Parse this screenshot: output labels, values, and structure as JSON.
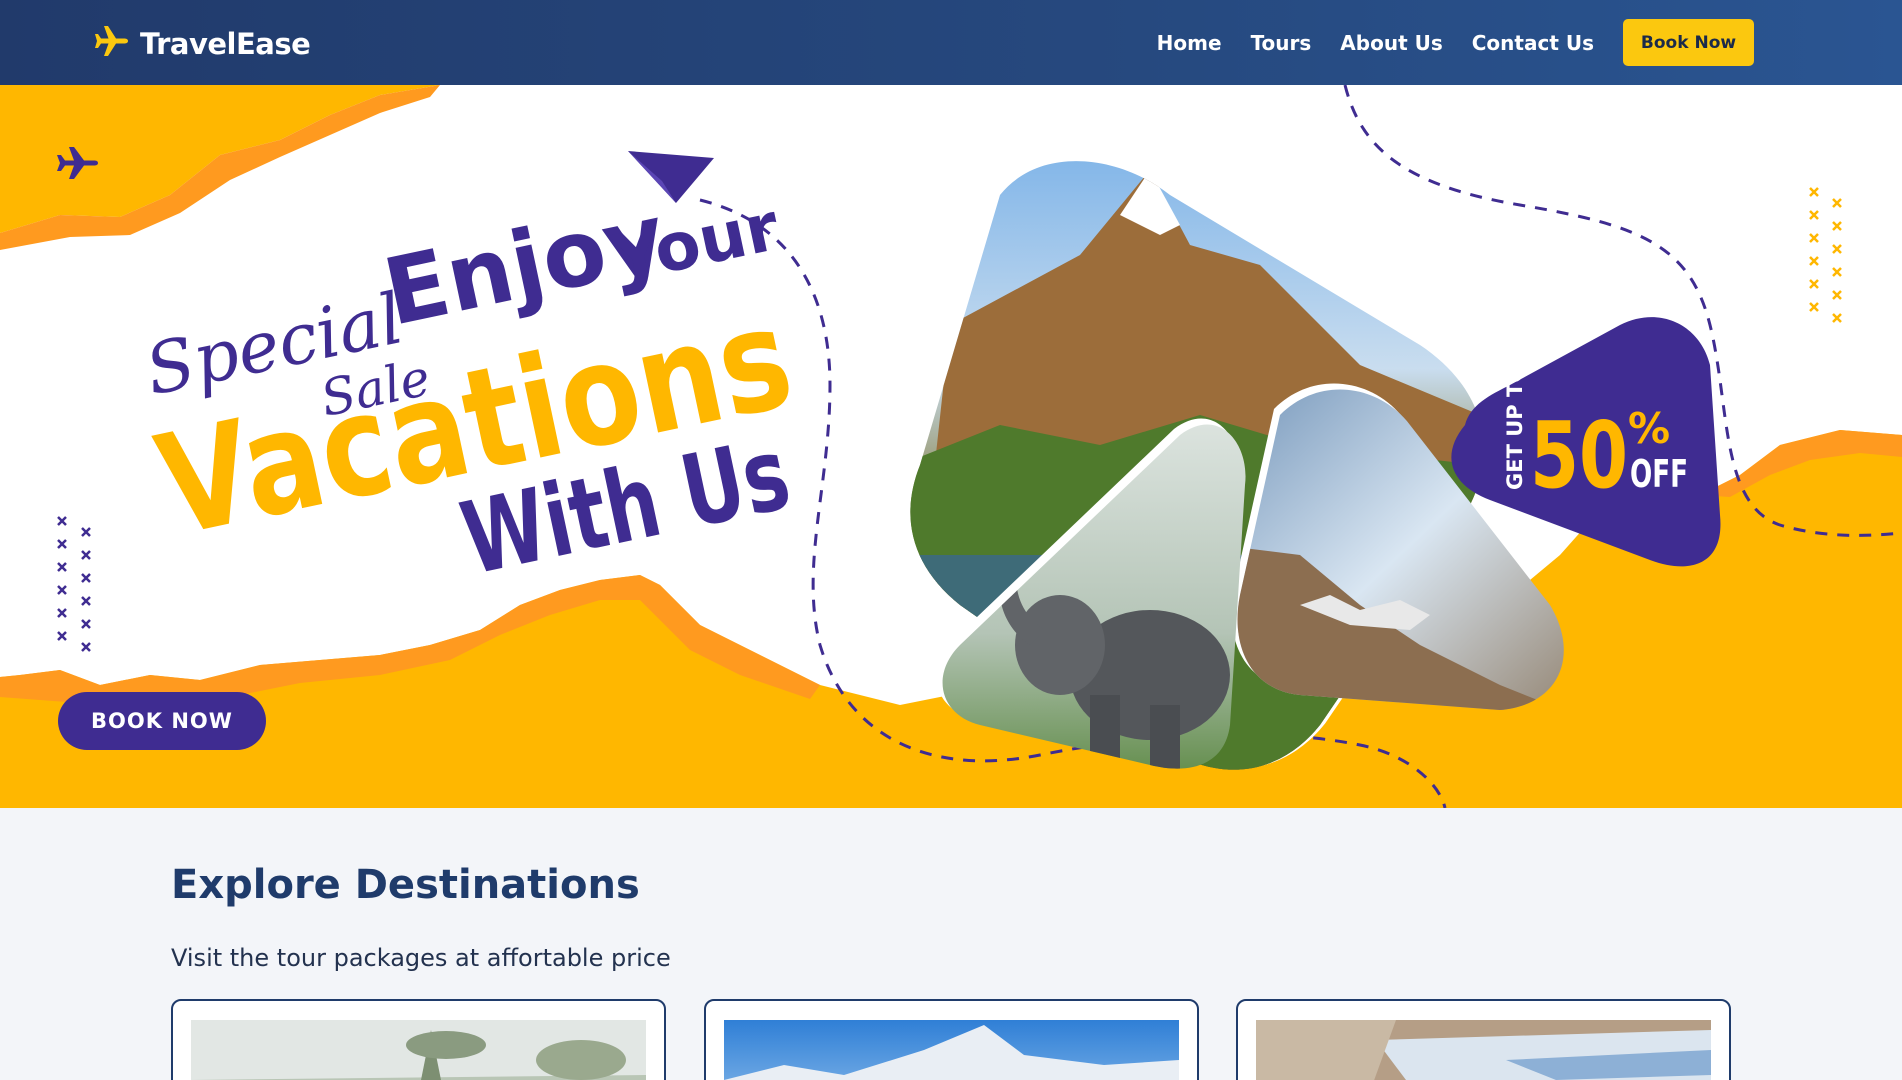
{
  "navbar": {
    "brand": "TravelEase",
    "brand_icon": "plane-icon",
    "links": [
      "Home",
      "Tours",
      "About Us",
      "Contact Us"
    ],
    "cta": "Book Now"
  },
  "hero": {
    "script_line1": "Special",
    "script_line2": "Sale",
    "headline_enjoy": "Enjoy",
    "headline_your": "Your",
    "headline_vacations": "Vacations",
    "headline_with_us": "With Us",
    "badge_prefix": "GET UP TO",
    "badge_value": "50",
    "badge_percent": "%",
    "badge_off": "OFF",
    "button": "BOOK NOW",
    "colors": {
      "yellow": "#ffb700",
      "purple": "#3f2c91",
      "white": "#ffffff"
    }
  },
  "explore": {
    "title": "Explore Destinations",
    "subtitle": "Visit the tour packages at affortable price",
    "cards": [
      {
        "image": "misty-wetland-photo"
      },
      {
        "image": "snowy-mountain-peak-photo"
      },
      {
        "image": "river-valley-photo"
      }
    ]
  }
}
